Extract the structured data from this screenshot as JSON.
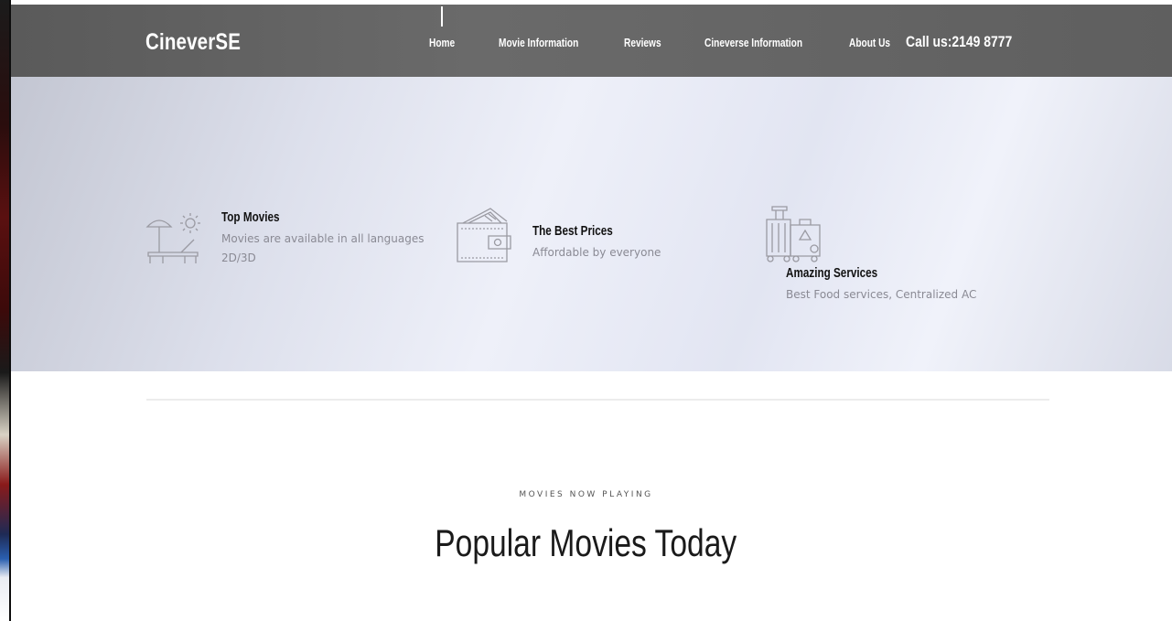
{
  "header": {
    "logo": "CineverSE",
    "nav": [
      "Home",
      "Movie Information",
      "Reviews",
      "Cineverse Information",
      "About Us"
    ],
    "active_nav": "Home",
    "call": "Call us:2149 8777"
  },
  "features": [
    {
      "icon": "beach-chair-icon",
      "title": "Top Movies",
      "lines": [
        "Movies are available in all languages",
        "2D/3D"
      ]
    },
    {
      "icon": "wallet-icon",
      "title": "The Best Prices",
      "lines": [
        "Affordable by everyone"
      ]
    },
    {
      "icon": "luggage-icon",
      "title": "Amazing Services",
      "lines": [
        "Best Food services, Centralized AC"
      ]
    }
  ],
  "section": {
    "kicker": "MOVIES NOW PLAYING",
    "title": "Popular Movies Today"
  },
  "colors": {
    "header_bg": "#5f5f5f",
    "hero_bg": "#e4e7f3",
    "text_dark": "#111111",
    "text_muted": "#8a8a94",
    "icon_stroke": "#9a9aa2"
  }
}
